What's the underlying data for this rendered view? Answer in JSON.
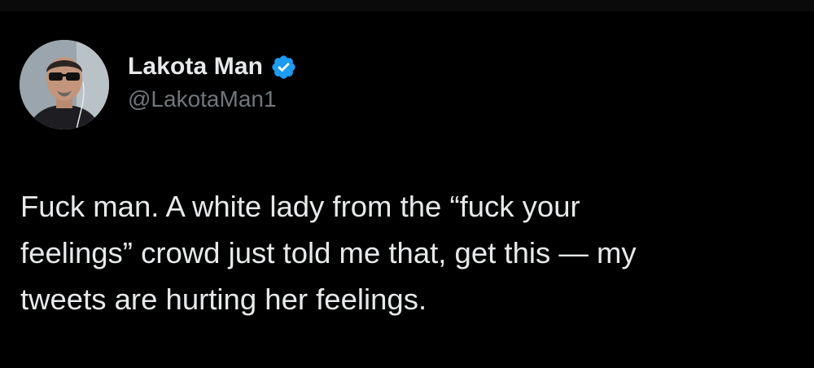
{
  "author": {
    "display_name": "Lakota Man",
    "handle": "@LakotaMan1",
    "verified": true,
    "verified_icon": "verified-badge-icon",
    "verified_color": "#1d9bf0"
  },
  "tweet": {
    "text": "Fuck man. A white lady from the “fuck your\nfeelings” crowd just told me that, get this — my\ntweets are hurting her feelings."
  },
  "theme": {
    "background": "#000000",
    "text_color": "#e7e9ea",
    "secondary_text_color": "#71767b"
  }
}
